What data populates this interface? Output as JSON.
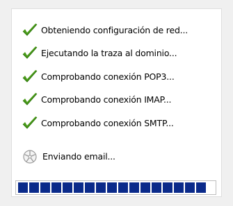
{
  "steps": [
    {
      "label": "Obteniendo configuración de red...",
      "status": "done",
      "icon": "check-icon"
    },
    {
      "label": "Ejecutando la traza al dominio...",
      "status": "done",
      "icon": "check-icon"
    },
    {
      "label": "Comprobando conexión POP3...",
      "status": "done",
      "icon": "check-icon"
    },
    {
      "label": "Comprobando conexión IMAP...",
      "status": "done",
      "icon": "check-icon"
    },
    {
      "label": "Comprobando conexión SMTP...",
      "status": "done",
      "icon": "check-icon"
    },
    {
      "label": "Enviando email...",
      "status": "in-progress",
      "icon": "spinner-icon"
    }
  ],
  "progress": {
    "filled_blocks": 17,
    "color": "#0a2a8a"
  },
  "colors": {
    "check": "#4a9a1a"
  }
}
